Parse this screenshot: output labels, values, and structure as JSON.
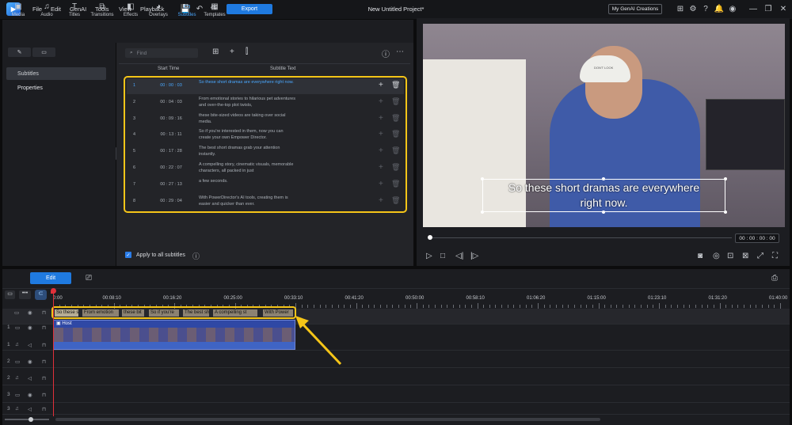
{
  "menubar": {
    "items": [
      "File",
      "Edit",
      "GenAI",
      "Tools",
      "View",
      "Playback"
    ],
    "export_label": "Export",
    "project_title": "New Untitled Project*",
    "genai_creations": "My GenAI Creations"
  },
  "rooms": [
    {
      "label": "Media",
      "icon": "▣"
    },
    {
      "label": "Audio",
      "icon": "♫"
    },
    {
      "label": "Titles",
      "icon": "T"
    },
    {
      "label": "Transitions",
      "icon": "⧉"
    },
    {
      "label": "Effects",
      "icon": "◧"
    },
    {
      "label": "Overlays",
      "icon": "◕"
    },
    {
      "label": "Subtitles",
      "icon": "▭"
    },
    {
      "label": "Templates",
      "icon": "▦"
    }
  ],
  "active_room": "Subtitles",
  "left_nav": {
    "items": [
      "Subtitles",
      "Properties"
    ]
  },
  "subtitle_panel": {
    "search_placeholder": "Find",
    "col_start": "Start Time",
    "col_text": "Subtitle Text",
    "rows": [
      {
        "num": "1",
        "time": "00 : 00 : 03",
        "text": "So these short dramas are everywhere right now."
      },
      {
        "num": "2",
        "time": "00 : 04 : 03",
        "text": "From emotional stories to hilarious pet adventures and over-the-top plot twists,"
      },
      {
        "num": "3",
        "time": "00 : 09 : 16",
        "text": "these bite-sized videos are taking over social media."
      },
      {
        "num": "4",
        "time": "00 : 13 : 11",
        "text": "So if you're interested in them, now you can create your own Empower Director."
      },
      {
        "num": "5",
        "time": "00 : 17 : 28",
        "text": "The best short dramas grab your attention instantly."
      },
      {
        "num": "6",
        "time": "00 : 22 : 07",
        "text": "A compelling story, cinematic visuals, memorable characters, all packed in just"
      },
      {
        "num": "7",
        "time": "00 : 27 : 13",
        "text": "a few seconds."
      },
      {
        "num": "8",
        "time": "00 : 29 : 04",
        "text": "With PowerDirector's AI tools, creating them is easier and quicker than ever."
      }
    ],
    "apply_all_label": "Apply to all subtitles"
  },
  "preview": {
    "subtitle_line1": "So these short dramas are everywhere",
    "subtitle_line2": "right now.",
    "timecode": "00 : 00 : 00 : 00",
    "cap_text": "DON'T LOOK"
  },
  "timeline": {
    "edit_label": "Edit",
    "ruler": [
      "0:00",
      "00:08:10",
      "00:16:20",
      "00:25:00",
      "00:33:10",
      "00:41:20",
      "00:50:00",
      "00:58:10",
      "01:06:20",
      "01:15:00",
      "01:23:10",
      "01:31:20",
      "01:40:00"
    ],
    "subtitle_clips": [
      "So these s",
      "From emotion",
      "these bit",
      "So if you're",
      "The best sh",
      "A compelling st",
      "With Power"
    ],
    "video_clip_label": "Host",
    "track_numbers": [
      "1",
      "1",
      "2",
      "2",
      "3",
      "3"
    ]
  }
}
